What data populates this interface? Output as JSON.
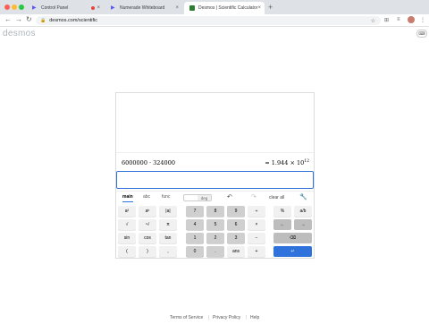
{
  "browser": {
    "tabs": [
      {
        "label": "Control Panel",
        "active": false
      },
      {
        "label": "Numerade Whiteboard",
        "active": false
      },
      {
        "label": "Desmos | Scientific Calculator",
        "active": true
      }
    ],
    "url": "desmos.com/scientific",
    "new_tab": "+",
    "close_glyph": "×",
    "nav_back": "←",
    "nav_forward": "→",
    "nav_reload": "↻"
  },
  "app": {
    "logo": "desmos",
    "expression": "6000000 · 324000",
    "result_prefix": "≈ 1.944 × 10",
    "result_exponent": "12",
    "keypad_tabs": [
      "main",
      "abc",
      "func"
    ],
    "deg_label": "",
    "rad_label": "deg",
    "undo": "↶",
    "redo": "↷",
    "clear_all": "clear all",
    "settings": "🔧",
    "keys": {
      "row1": [
        "a²",
        "aᵇ",
        "|a|",
        "7",
        "8",
        "9",
        "÷",
        "%",
        "a/b"
      ],
      "row2": [
        "√",
        "ⁿ√",
        "π",
        "4",
        "5",
        "6",
        "×",
        "←",
        "→"
      ],
      "row3": [
        "sin",
        "cos",
        "tan",
        "1",
        "2",
        "3",
        "−",
        "⌫"
      ],
      "row4": [
        "(",
        ")",
        ",",
        "0",
        ".",
        "ans",
        "+",
        "↵"
      ]
    }
  },
  "footer": {
    "terms": "Terms of Service",
    "privacy": "Privacy Policy",
    "help": "Help",
    "separator": "|"
  },
  "colors": {
    "accent": "#2f72dc",
    "tabbar": "#dee1e6"
  }
}
